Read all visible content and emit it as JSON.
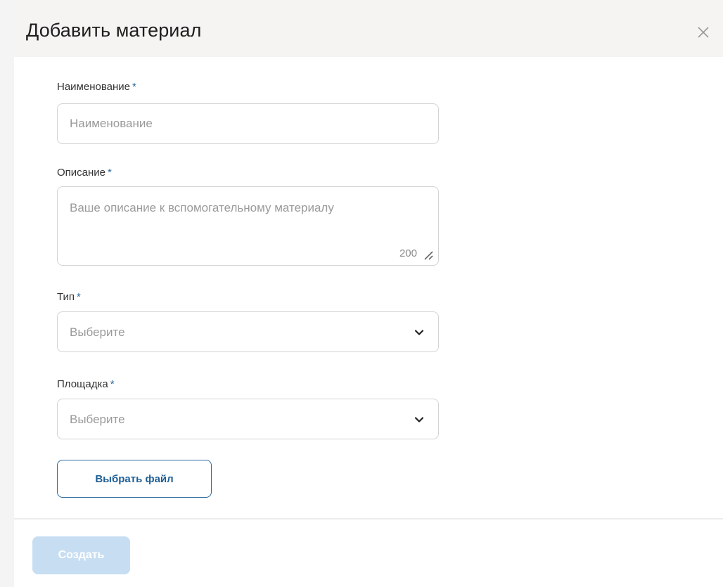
{
  "dialog": {
    "title": "Добавить материал"
  },
  "form": {
    "name": {
      "label": "Наименование",
      "required_mark": "*",
      "placeholder": "Наименование",
      "value": ""
    },
    "description": {
      "label": "Описание",
      "required_mark": "*",
      "placeholder": "Ваше описание к вспомогательному материалу",
      "counter": "200"
    },
    "type": {
      "label": "Тип",
      "required_mark": "*",
      "selected": "Выберите"
    },
    "venue": {
      "label": "Площадка",
      "required_mark": "*",
      "selected": "Выберите"
    },
    "file_button_label": "Выбрать файл"
  },
  "footer": {
    "create_label": "Создать",
    "create_enabled": false
  },
  "colors": {
    "accent": "#2a6aa0",
    "header_bg": "#f5f4f3",
    "disabled_button": "#c7def2"
  }
}
